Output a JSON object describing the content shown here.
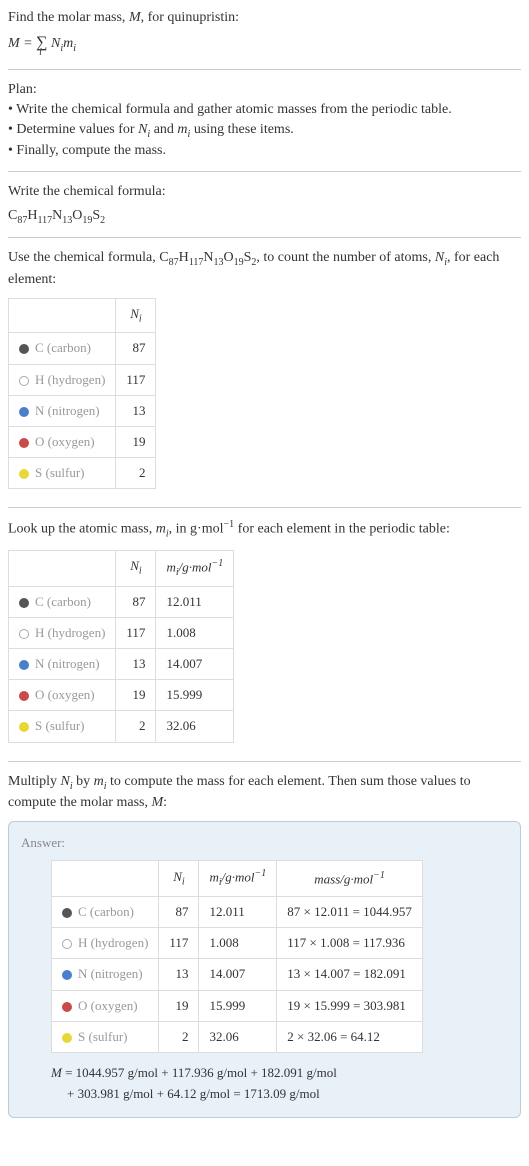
{
  "intro": {
    "line1": "Find the molar mass, ",
    "line1_var": "M",
    "line1_end": ", for quinupristin:",
    "formula_M": "M",
    "formula_eq": " = ",
    "formula_sum": "∑",
    "formula_sub": "i",
    "formula_Ni": " N",
    "formula_i1": "i",
    "formula_mi": "m",
    "formula_i2": "i"
  },
  "plan": {
    "title": "Plan:",
    "bullet1": "• Write the chemical formula and gather atomic masses from the periodic table.",
    "bullet2_a": "• Determine values for ",
    "bullet2_Ni": "N",
    "bullet2_i1": "i",
    "bullet2_and": " and ",
    "bullet2_mi": "m",
    "bullet2_i2": "i",
    "bullet2_end": " using these items.",
    "bullet3": "• Finally, compute the mass."
  },
  "chem": {
    "title": "Write the chemical formula:",
    "C": "C",
    "Cn": "87",
    "H": "H",
    "Hn": "117",
    "N": "N",
    "Nn": "13",
    "O": "O",
    "On": "19",
    "S": "S",
    "Sn": "2"
  },
  "count": {
    "text_a": "Use the chemical formula, ",
    "text_b": ", to count the number of atoms, ",
    "Ni": "N",
    "i": "i",
    "text_c": ", for each element:",
    "header_Ni": "N",
    "header_i": "i",
    "elements": [
      {
        "sym": "C",
        "name": "(carbon)",
        "n": "87"
      },
      {
        "sym": "H",
        "name": "(hydrogen)",
        "n": "117"
      },
      {
        "sym": "N",
        "name": "(nitrogen)",
        "n": "13"
      },
      {
        "sym": "O",
        "name": "(oxygen)",
        "n": "19"
      },
      {
        "sym": "S",
        "name": "(sulfur)",
        "n": "2"
      }
    ]
  },
  "lookup": {
    "text_a": "Look up the atomic mass, ",
    "mi": "m",
    "i": "i",
    "text_b": ", in g·mol",
    "exp": "−1",
    "text_c": " for each element in the periodic table:",
    "header_Ni": "N",
    "header_Ni_i": "i",
    "header_mi": "m",
    "header_mi_i": "i",
    "header_unit": "/g·mol",
    "header_exp": "−1",
    "rows": [
      {
        "sym": "C",
        "name": "(carbon)",
        "n": "87",
        "m": "12.011"
      },
      {
        "sym": "H",
        "name": "(hydrogen)",
        "n": "117",
        "m": "1.008"
      },
      {
        "sym": "N",
        "name": "(nitrogen)",
        "n": "13",
        "m": "14.007"
      },
      {
        "sym": "O",
        "name": "(oxygen)",
        "n": "19",
        "m": "15.999"
      },
      {
        "sym": "S",
        "name": "(sulfur)",
        "n": "2",
        "m": "32.06"
      }
    ]
  },
  "multiply": {
    "text_a": "Multiply ",
    "Ni": "N",
    "i1": "i",
    "text_b": " by ",
    "mi": "m",
    "i2": "i",
    "text_c": " to compute the mass for each element. Then sum those values to compute the molar mass, ",
    "M": "M",
    "text_d": ":"
  },
  "answer": {
    "label": "Answer:",
    "header_Ni": "N",
    "header_Ni_i": "i",
    "header_mi": "m",
    "header_mi_i": "i",
    "header_mi_unit": "/g·mol",
    "header_mi_exp": "−1",
    "header_mass": "mass/g·mol",
    "header_mass_exp": "−1",
    "rows": [
      {
        "sym": "C",
        "name": "(carbon)",
        "n": "87",
        "m": "12.011",
        "calc": "87 × 12.011 = 1044.957"
      },
      {
        "sym": "H",
        "name": "(hydrogen)",
        "n": "117",
        "m": "1.008",
        "calc": "117 × 1.008 = 117.936"
      },
      {
        "sym": "N",
        "name": "(nitrogen)",
        "n": "13",
        "m": "14.007",
        "calc": "13 × 14.007 = 182.091"
      },
      {
        "sym": "O",
        "name": "(oxygen)",
        "n": "19",
        "m": "15.999",
        "calc": "19 × 15.999 = 303.981"
      },
      {
        "sym": "S",
        "name": "(sulfur)",
        "n": "2",
        "m": "32.06",
        "calc": "2 × 32.06 = 64.12"
      }
    ],
    "final_M": "M",
    "final_line1": " = 1044.957 g/mol + 117.936 g/mol + 182.091 g/mol",
    "final_line2": "+ 303.981 g/mol + 64.12 g/mol = 1713.09 g/mol"
  }
}
